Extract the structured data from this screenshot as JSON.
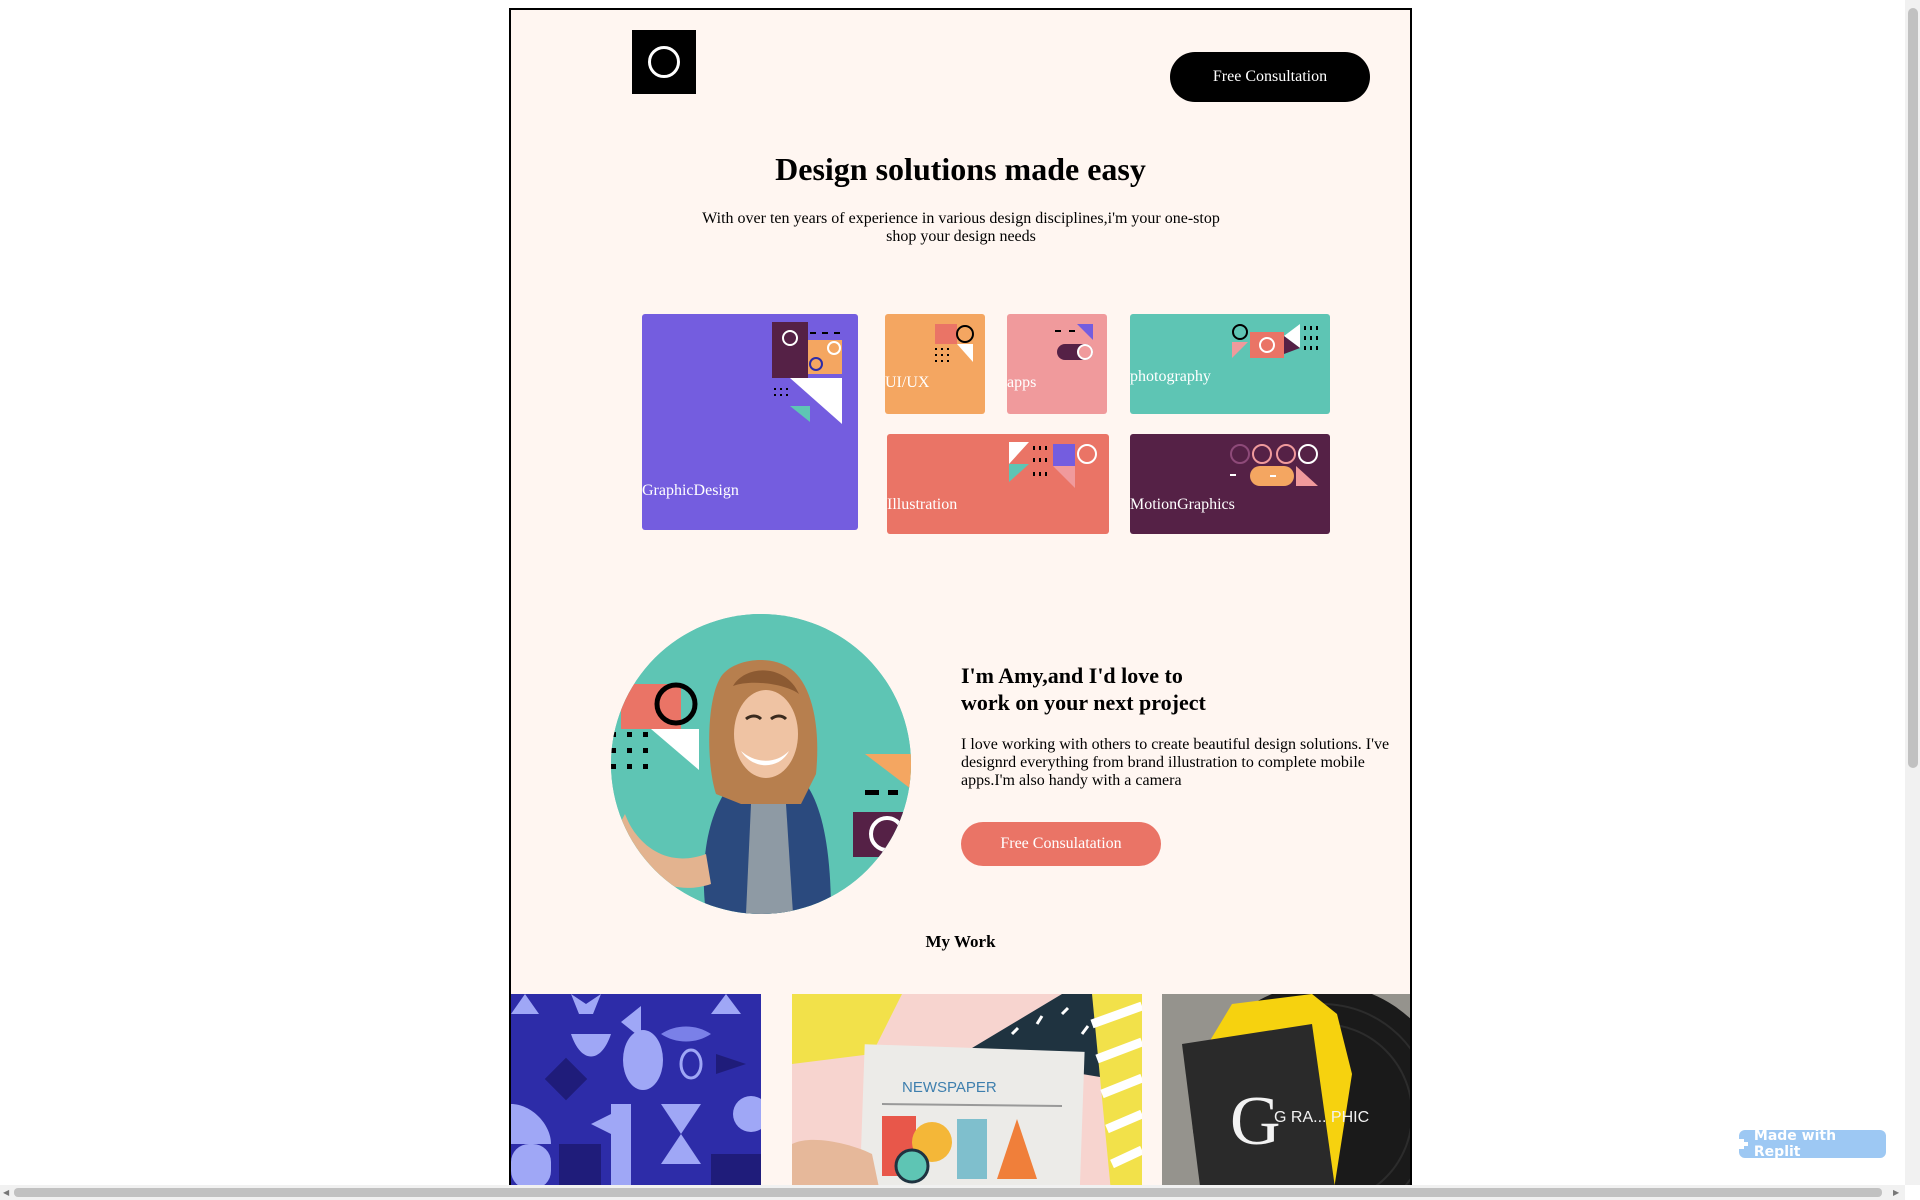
{
  "header": {
    "consult_label": "Free Consultation"
  },
  "hero": {
    "title": "Design solutions made easy",
    "subtitle": "With over ten years of experience in various design disciplines,i'm your one-stop shop your design needs"
  },
  "services": {
    "graphic": "GraphicDesign",
    "uiux": "UI/UX",
    "apps": "apps",
    "photography": "photography",
    "illustration": "Illustration",
    "motion": "MotionGraphics"
  },
  "about": {
    "title_line1": "I'm Amy,and I'd love to",
    "title_line2": "work on your next project",
    "text": "I love working with others to create beautiful design solutions. I've designrd everything from brand illustration to complete mobile apps.I'm also handy with a camera",
    "button_label": "Free Consulatation"
  },
  "work": {
    "title": "My Work",
    "newspaper_text": "NEWSPAPER",
    "book_letters": "G RA... PHIC"
  },
  "badge": {
    "label": "Made with Replit"
  },
  "colors": {
    "page_bg": "#fff6f1",
    "purple": "#745ddf",
    "orange": "#f4a661",
    "pink": "#f09a9c",
    "teal": "#5ec5b4",
    "coral": "#ea7466",
    "plum": "#552146"
  }
}
